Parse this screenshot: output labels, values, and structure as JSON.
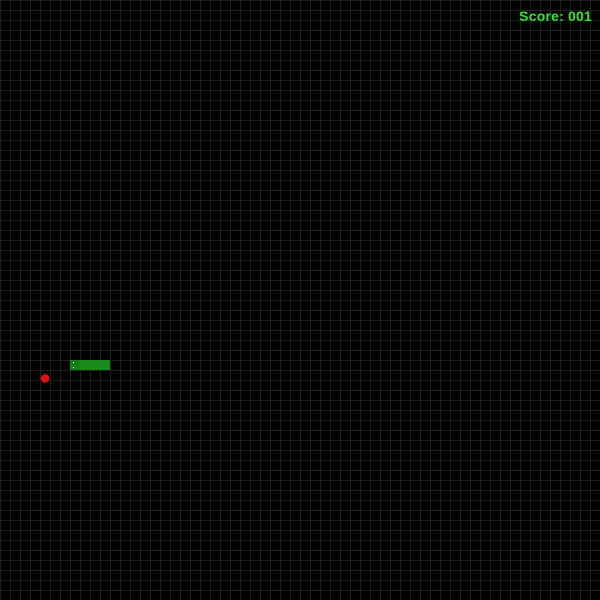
{
  "hud": {
    "score_text": "Score: 001"
  },
  "game": {
    "score": 1,
    "direction": "left",
    "snake_length": 4,
    "colors": {
      "background": "#000000",
      "grid_line": "#1f1f1f",
      "snake_body": "#1a8a1a",
      "snake_head": "#168016",
      "snake_eye": "#ffffff",
      "food": "#e01010",
      "score_text": "#33e633"
    },
    "food_icon": "apple-icon"
  }
}
